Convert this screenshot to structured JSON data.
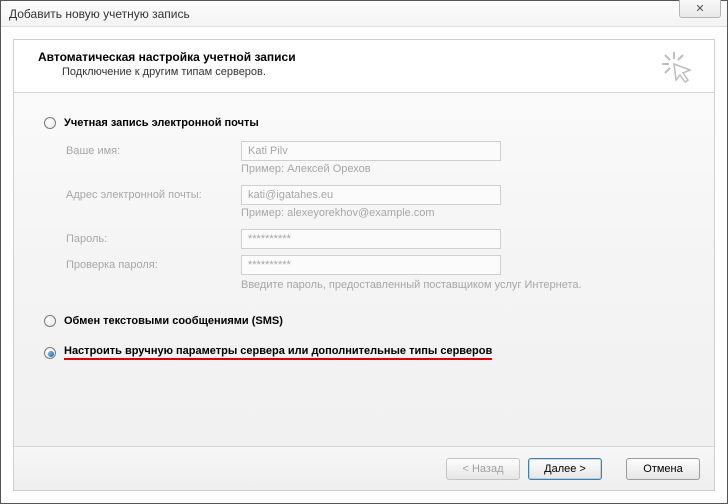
{
  "window": {
    "title": "Добавить новую учетную запись",
    "close_symbol": "✕"
  },
  "header": {
    "title": "Автоматическая настройка учетной записи",
    "subtitle": "Подключение к другим типам серверов."
  },
  "options": {
    "email_label": "Учетная запись электронной почты",
    "sms_label": "Обмен текстовыми сообщениями (SMS)",
    "manual_label": "Настроить вручную параметры сервера или дополнительные типы серверов"
  },
  "fields": {
    "name_label": "Ваше имя:",
    "name_value": "Kati Pilv",
    "name_example": "Пример: Алексей Орехов",
    "email_label": "Адрес электронной почты:",
    "email_value": "kati@igatahes.eu",
    "email_example": "Пример: alexeyorekhov@example.com",
    "password_label": "Пароль:",
    "password_value": "**********",
    "password2_label": "Проверка пароля:",
    "password2_value": "**********",
    "password_hint": "Введите пароль, предоставленный поставщиком услуг Интернета."
  },
  "buttons": {
    "back": "< Назад",
    "next": "Далее >",
    "cancel": "Отмена"
  }
}
